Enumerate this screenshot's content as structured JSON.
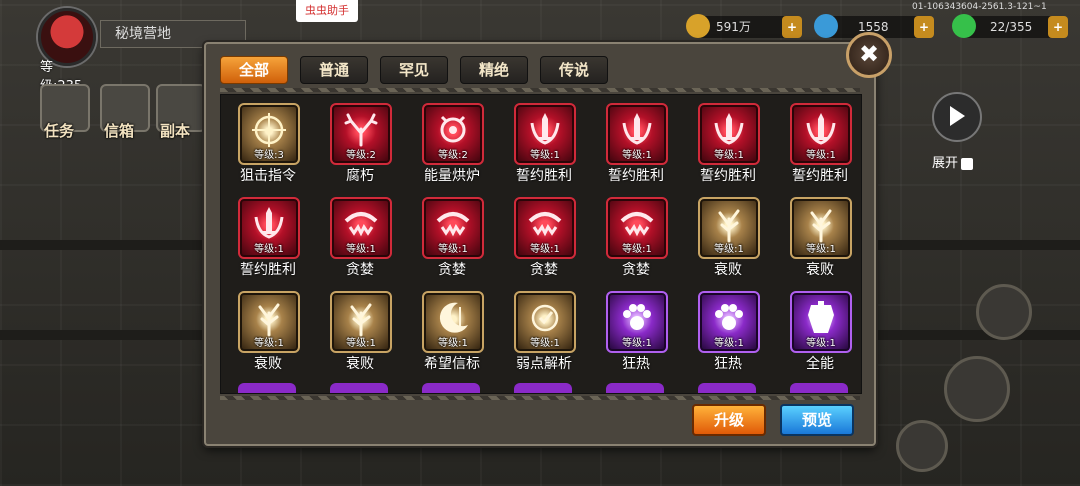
{
  "hud": {
    "base_name": "秘境营地",
    "player_level": "等级:235",
    "side_buttons": [
      "任务",
      "信箱",
      "副本"
    ],
    "helper_badge": "虫虫助手",
    "resources": [
      {
        "value": "591万",
        "icon": "gold-coin-icon",
        "color": "#d8a22a"
      },
      {
        "value": "1558",
        "icon": "blue-gem-icon",
        "color": "#3a9ad8"
      },
      {
        "value": "22/355",
        "icon": "green-crystal-icon",
        "color": "#36c04a"
      }
    ],
    "device_id": "01-106343604-2561.3-121~1",
    "expand_label": "展开"
  },
  "panel": {
    "tabs": [
      "全部",
      "普通",
      "罕见",
      "精绝",
      "传说"
    ],
    "active_tab": 0,
    "skills": [
      {
        "name": "狙击指令",
        "level": "等级:3",
        "rarity": "gold",
        "icon": "crosshair-icon"
      },
      {
        "name": "腐朽",
        "level": "等级:2",
        "rarity": "red",
        "icon": "antler-icon"
      },
      {
        "name": "能量烘炉",
        "level": "等级:2",
        "rarity": "red",
        "icon": "furnace-icon"
      },
      {
        "name": "誓约胜利",
        "level": "等级:1",
        "rarity": "red",
        "icon": "sword-crest-icon"
      },
      {
        "name": "誓约胜利",
        "level": "等级:1",
        "rarity": "red",
        "icon": "sword-crest-icon"
      },
      {
        "name": "誓约胜利",
        "level": "等级:1",
        "rarity": "red",
        "icon": "sword-crest-icon"
      },
      {
        "name": "誓约胜利",
        "level": "等级:1",
        "rarity": "red",
        "icon": "sword-crest-icon"
      },
      {
        "name": "誓约胜利",
        "level": "等级:1",
        "rarity": "red",
        "icon": "sword-crest-icon"
      },
      {
        "name": "贪婪",
        "level": "等级:1",
        "rarity": "red",
        "icon": "greed-mouth-icon"
      },
      {
        "name": "贪婪",
        "level": "等级:1",
        "rarity": "red",
        "icon": "greed-mouth-icon"
      },
      {
        "name": "贪婪",
        "level": "等级:1",
        "rarity": "red",
        "icon": "greed-mouth-icon"
      },
      {
        "name": "贪婪",
        "level": "等级:1",
        "rarity": "red",
        "icon": "greed-mouth-icon"
      },
      {
        "name": "衰败",
        "level": "等级:1",
        "rarity": "gold",
        "icon": "dead-tree-icon"
      },
      {
        "name": "衰败",
        "level": "等级:1",
        "rarity": "gold",
        "icon": "dead-tree-icon"
      },
      {
        "name": "衰败",
        "level": "等级:1",
        "rarity": "gold",
        "icon": "dead-tree-icon"
      },
      {
        "name": "衰败",
        "level": "等级:1",
        "rarity": "gold",
        "icon": "dead-tree-icon"
      },
      {
        "name": "希望信标",
        "level": "等级:1",
        "rarity": "gold",
        "icon": "crescent-beacon-icon"
      },
      {
        "name": "弱点解析",
        "level": "等级:1",
        "rarity": "gold",
        "icon": "weakpoint-icon"
      },
      {
        "name": "狂热",
        "level": "等级:1",
        "rarity": "purple",
        "icon": "paw-icon"
      },
      {
        "name": "狂热",
        "level": "等级:1",
        "rarity": "purple",
        "icon": "paw-icon"
      },
      {
        "name": "全能",
        "level": "等级:1",
        "rarity": "purple",
        "icon": "armor-icon"
      }
    ],
    "upgrade_label": "升级",
    "preview_label": "预览",
    "close_symbol": "✖"
  }
}
